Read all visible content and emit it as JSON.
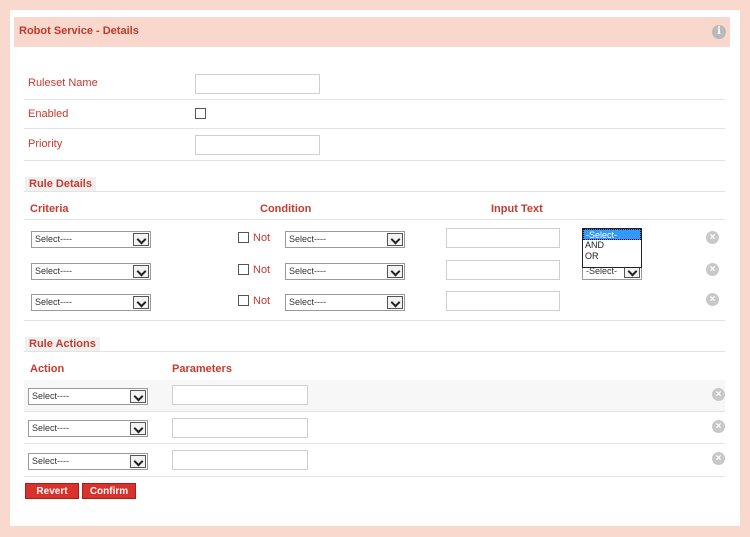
{
  "header": {
    "title": "Robot Service - Details"
  },
  "form": {
    "ruleset_name_label": "Ruleset Name",
    "enabled_label": "Enabled",
    "priority_label": "Priority"
  },
  "rule_details": {
    "section_title": "Rule Details",
    "col_criteria": "Criteria",
    "col_condition": "Condition",
    "col_input_text": "Input Text",
    "rows": [
      {
        "criteria": "Select----",
        "not_label": "Not",
        "condition": "Select----"
      },
      {
        "criteria": "Select----",
        "not_label": "Not",
        "condition": "Select----",
        "logic": "-Select-"
      },
      {
        "criteria": "Select----",
        "not_label": "Not",
        "condition": "Select----"
      }
    ],
    "logic_dropdown": {
      "options": [
        "-Select-",
        "AND",
        "OR"
      ],
      "selected": "-Select-"
    }
  },
  "rule_actions": {
    "section_title": "Rule Actions",
    "col_action": "Action",
    "col_parameters": "Parameters",
    "rows": [
      {
        "action": "Select----"
      },
      {
        "action": "Select----"
      },
      {
        "action": "Select----"
      }
    ]
  },
  "buttons": {
    "revert": "Revert",
    "confirm": "Confirm"
  },
  "icons": {
    "info": "info-icon",
    "remove": "remove-icon"
  },
  "colors": {
    "accent": "#c73a2e",
    "header_bg": "#f8d8cc",
    "page_bg": "#f9d9cd",
    "button": "#d9312b"
  }
}
